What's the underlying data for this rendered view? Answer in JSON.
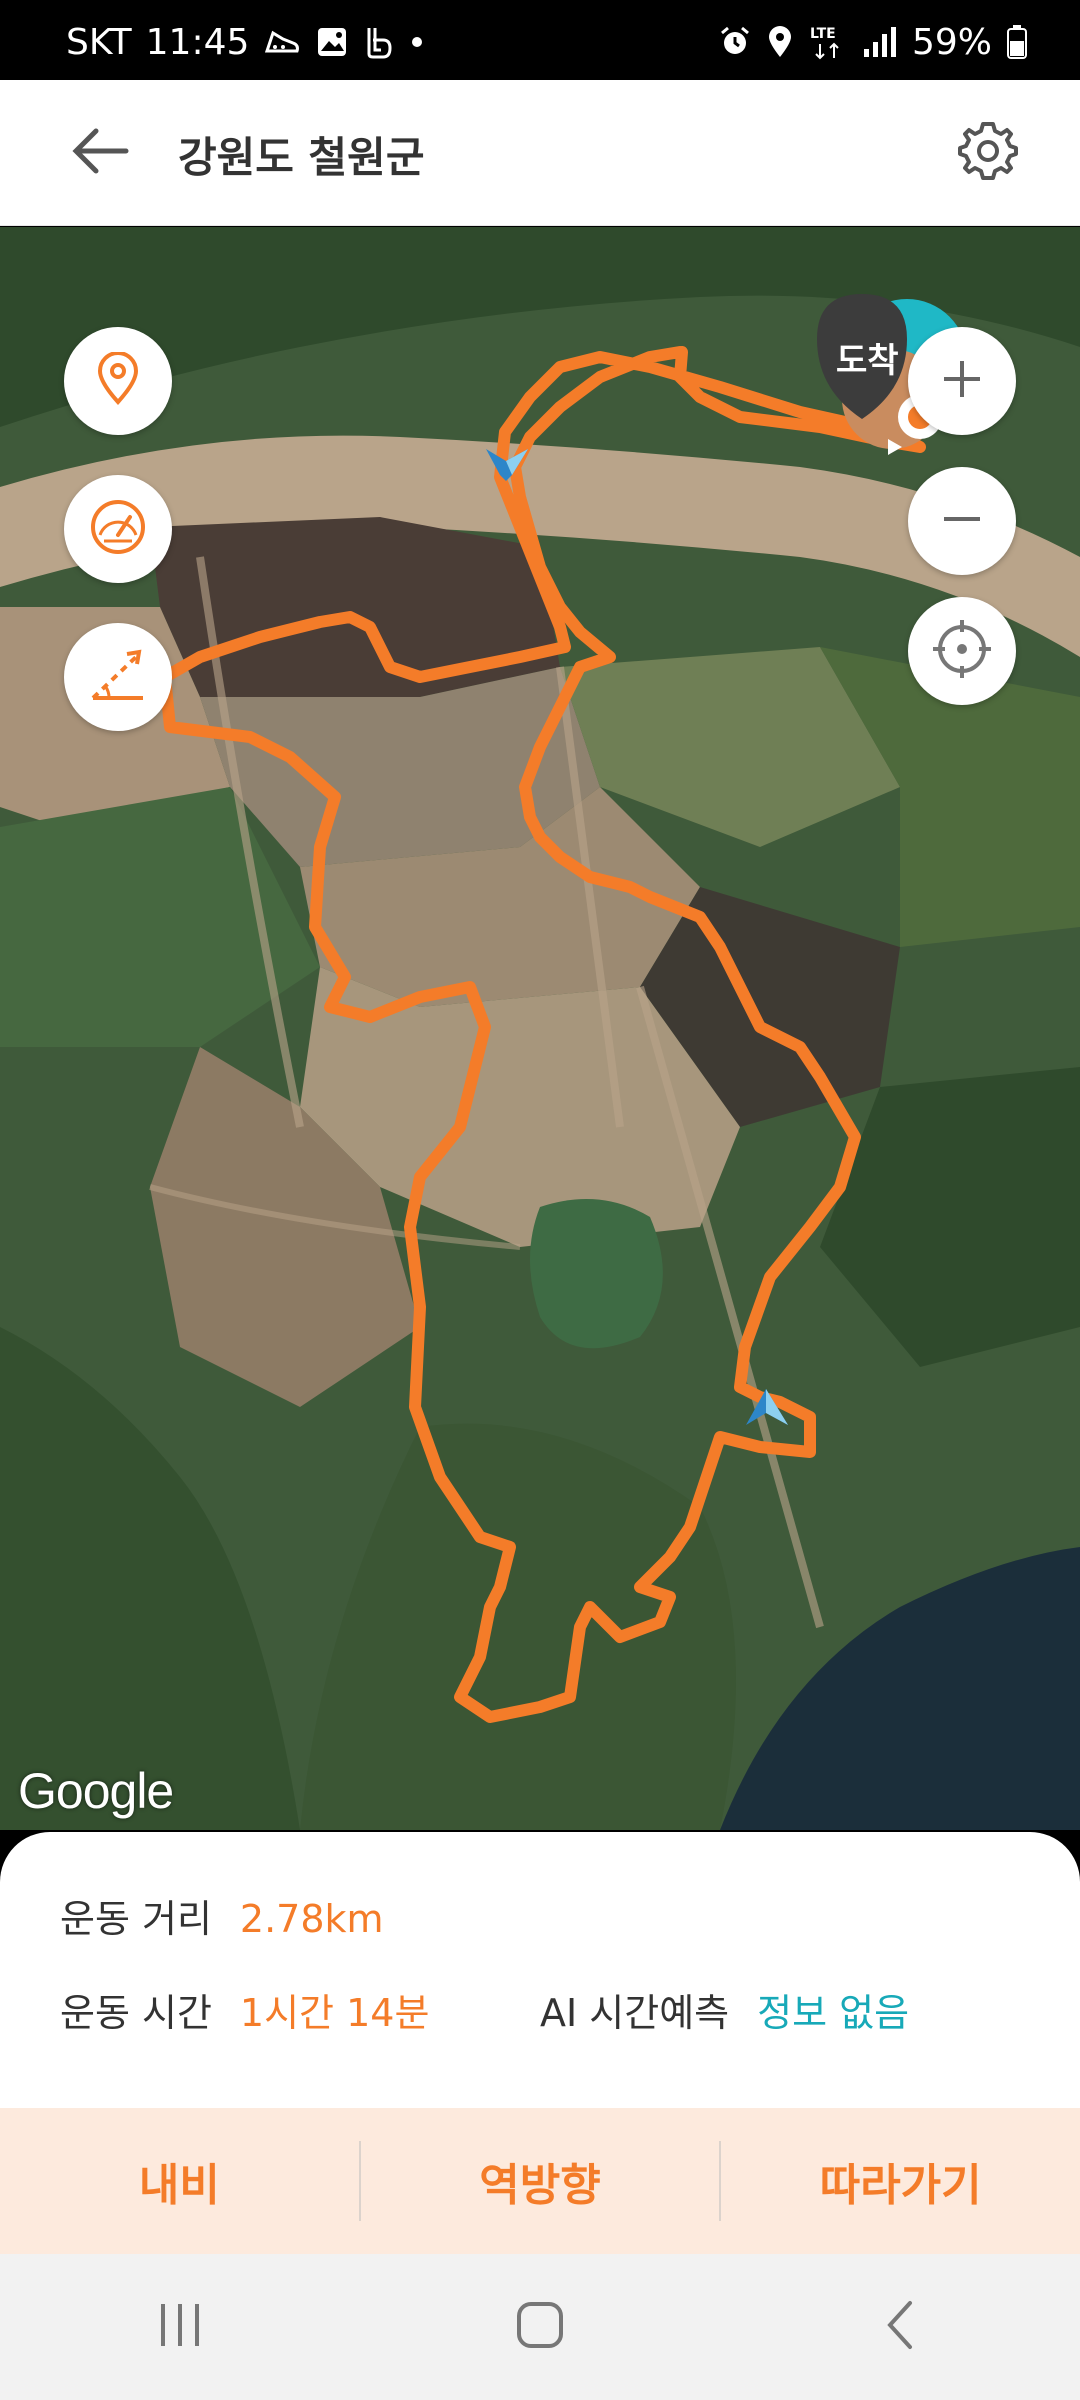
{
  "status_bar": {
    "carrier": "SKT",
    "time": "11:45",
    "network": "LTE",
    "battery": "59%",
    "icons": [
      "shoe-icon",
      "gallery-icon",
      "b-app-icon",
      "dot-icon",
      "alarm-icon",
      "location-icon",
      "lte-icon",
      "signal-icon",
      "battery-icon"
    ]
  },
  "header": {
    "title": "강원도 철원군",
    "back_icon": "arrow-left-icon",
    "settings_icon": "gear-icon"
  },
  "map": {
    "arrival_label": "도착",
    "attribution": "Google",
    "left_controls": [
      "location-pin-icon",
      "speedometer-icon",
      "slope-icon"
    ],
    "right_controls": [
      "zoom-in-icon",
      "zoom-out-icon",
      "crosshair-icon"
    ],
    "route_color": "#f47c29"
  },
  "info": {
    "distance_label": "운동 거리",
    "distance_value": "2.78km",
    "time_label": "운동 시간",
    "time_value": "1시간 14분",
    "ai_label": "AI 시간예측",
    "ai_value": "정보 없음"
  },
  "actions": {
    "navi": "내비",
    "reverse": "역방향",
    "follow": "따라가기"
  },
  "nav_bar": {
    "icons": [
      "recents-icon",
      "home-icon",
      "back-icon"
    ]
  },
  "colors": {
    "accent": "#f47c29",
    "cyan": "#17a9b8",
    "action_bg": "#fdeadd"
  }
}
